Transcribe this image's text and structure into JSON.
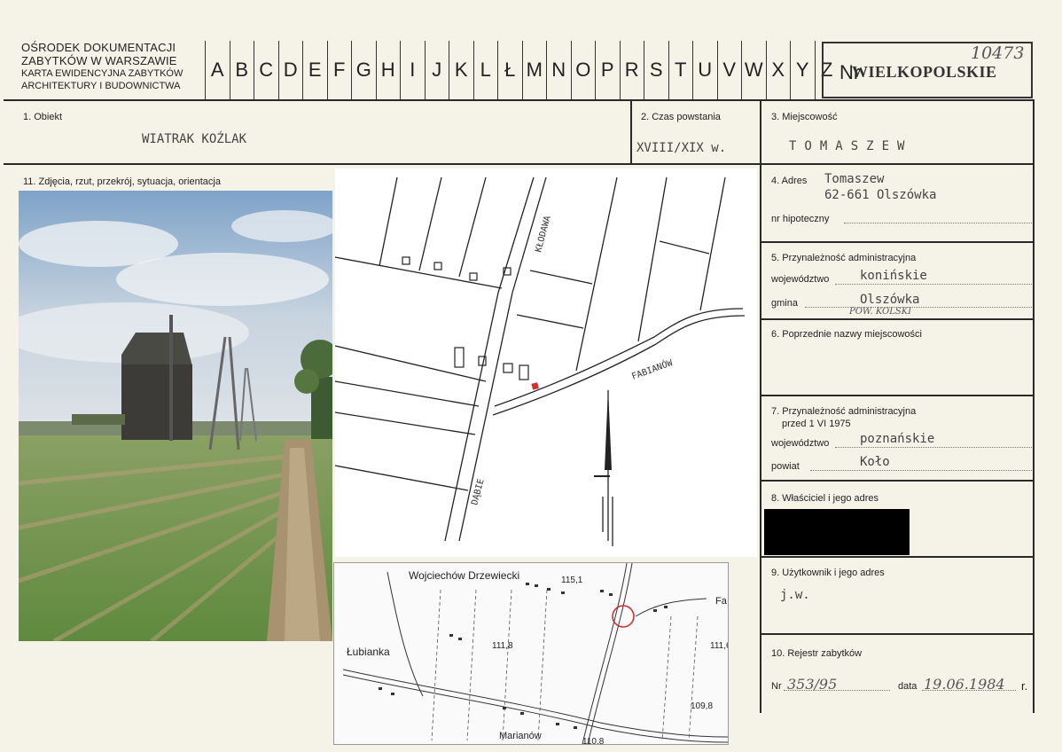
{
  "header": {
    "org_line1": "OŚRODEK DOKUMENTACJI",
    "org_line2": "ZABYTKÓW W WARSZAWIE",
    "org_line3": "KARTA EWIDENCYJNA ZABYTKÓW",
    "org_line4": "ARCHITEKTURY I BUDOWNICTWA",
    "letters": [
      "A",
      "B",
      "C",
      "D",
      "E",
      "F",
      "G",
      "H",
      "I",
      "J",
      "K",
      "L",
      "Ł",
      "M",
      "N",
      "O",
      "P",
      "R",
      "S",
      "T",
      "U",
      "V",
      "W",
      "X",
      "Y",
      "Z"
    ],
    "nr_label": "Nr",
    "province": "WIELKOPOLSKIE",
    "number_hand": "10473"
  },
  "fields": {
    "obiekt_label": "1. Obiekt",
    "obiekt_value": "WIATRAK KOŹLAK",
    "czas_label": "2. Czas powstania",
    "czas_value": "XVIII/XIX w.",
    "miejscowosc_label": "3. Miejscowość",
    "miejscowosc_value": "TOMASZEW",
    "zdjecia_label": "11. Zdjęcia, rzut, przekrój, sytuacja, orientacja",
    "adres_label": "4. Adres",
    "adres_line1": "Tomaszew",
    "adres_line2": "62-661 Olszówka",
    "hipoteczny_label": "nr hipoteczny",
    "admin_label": "5. Przynależność administracyjna",
    "wojewodztwo_label": "województwo",
    "wojewodztwo_value": "konińskie",
    "gmina_label": "gmina",
    "gmina_value": "Olszówka",
    "pow_hand": "POW. KOLSKI",
    "poprzednie_label": "6. Poprzednie nazwy miejscowości",
    "admin_old_label1": "7. Przynależność administracyjna",
    "admin_old_label2": "przed 1 VI 1975",
    "wojewodztwo_old_value": "poznańskie",
    "powiat_label": "powiat",
    "powiat_value": "Koło",
    "wlasciciel_label": "8. Właściciel i jego adres",
    "uzytkownik_label": "9. Użytkownik i jego adres",
    "uzytkownik_value": "j.w.",
    "rejestr_label": "10. Rejestr zabytków",
    "rejestr_nr_label": "Nr",
    "rejestr_nr_value": "353/95",
    "rejestr_data_label": "data",
    "rejestr_data_value": "19.06.1984",
    "rejestr_r": "r."
  },
  "sketch_map": {
    "road_labels": [
      "KŁODAWA",
      "FABIANÓW",
      "DĄBIE"
    ]
  },
  "topo_map": {
    "labels": [
      "Wojciechów Drzewiecki",
      "115,1",
      "Fa",
      "111,8",
      "111,6",
      "Łubianka",
      "109,8",
      "Marianów",
      "110,8"
    ]
  }
}
